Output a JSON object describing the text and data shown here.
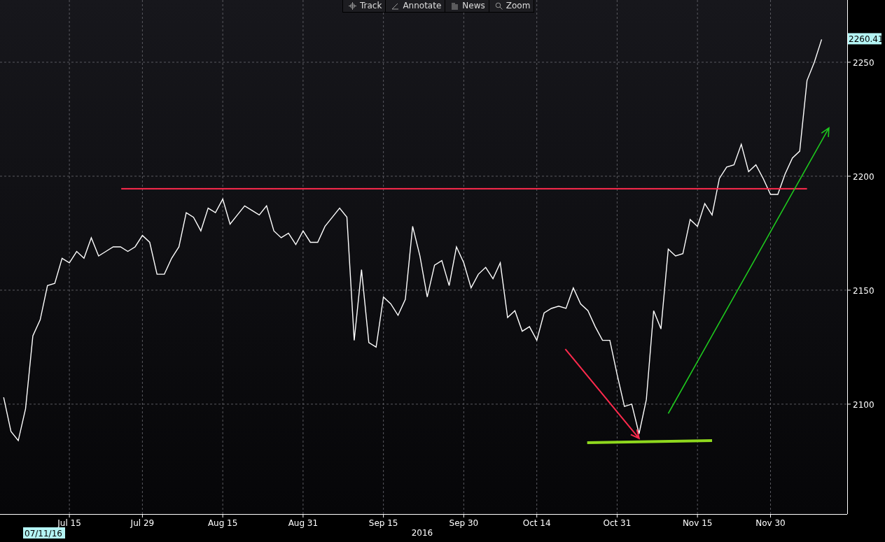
{
  "toolbar": [
    {
      "label": "Track",
      "kind": "track"
    },
    {
      "label": "Annotate",
      "kind": "annotate"
    },
    {
      "label": "News",
      "kind": "news"
    },
    {
      "label": "Zoom",
      "kind": "zoom"
    }
  ],
  "chart": {
    "last_price": "2260.41",
    "start_date": "07/11/16",
    "year_label": "2016",
    "drawings": [
      {
        "kind": "resistance",
        "color": "#ff2a4d"
      },
      {
        "kind": "down-arrow",
        "color": "#ff2a4d"
      },
      {
        "kind": "support",
        "color": "#8fd81e"
      },
      {
        "kind": "up-arrow",
        "color": "#1ec81e"
      }
    ],
    "chart_data": {
      "type": "line",
      "grid": true,
      "ylim": [
        2051.8,
        2277.3
      ],
      "yticks": [
        2100,
        2150,
        2200,
        2250
      ],
      "categories": [
        null,
        null,
        null,
        null,
        null,
        null,
        null,
        null,
        null,
        "Jul 15",
        null,
        null,
        null,
        null,
        null,
        null,
        null,
        null,
        null,
        "Jul 29",
        null,
        null,
        null,
        null,
        null,
        null,
        null,
        null,
        null,
        null,
        "Aug 15",
        null,
        null,
        null,
        null,
        null,
        null,
        null,
        null,
        null,
        null,
        "Aug 31",
        null,
        null,
        null,
        null,
        null,
        null,
        null,
        null,
        null,
        null,
        "Sep 15",
        null,
        null,
        null,
        null,
        null,
        null,
        null,
        null,
        null,
        null,
        "Sep 30",
        null,
        null,
        null,
        null,
        null,
        null,
        null,
        null,
        null,
        "Oct 14",
        null,
        null,
        null,
        null,
        null,
        null,
        null,
        null,
        null,
        null,
        "Oct 31",
        null,
        null,
        null,
        null,
        null,
        null,
        null,
        null,
        null,
        null,
        "Nov 15",
        null,
        null,
        null,
        null,
        null,
        null,
        null,
        null,
        null,
        "Nov 30",
        null,
        null,
        null,
        null,
        null,
        null,
        null,
        null,
        null,
        null
      ],
      "series": [
        {
          "color": "#ffffff",
          "values": [
            2103,
            2088,
            2084,
            2098,
            2130,
            2137,
            2152,
            2153,
            2164,
            2162,
            2167,
            2164,
            2173,
            2165,
            2167,
            2169,
            2169,
            2167,
            2169,
            2174,
            2171,
            2157,
            2157,
            2164,
            2169,
            2184,
            2182,
            2176,
            2186,
            2184,
            2190,
            2179,
            2183,
            2187,
            2185,
            2183,
            2187,
            2176,
            2173,
            2175,
            2170,
            2176,
            2171,
            2171,
            2178,
            2182,
            2186,
            2182,
            2128,
            2159,
            2127,
            2125,
            2147,
            2144,
            2139,
            2146,
            2178,
            2165,
            2147,
            2161,
            2163,
            2152,
            2169,
            2162,
            2151,
            2157,
            2160,
            2155,
            2162,
            2138,
            2141,
            2132,
            2134,
            2128,
            2140,
            2142,
            2143,
            2142,
            2151,
            2144,
            2141,
            2134,
            2128,
            2128,
            2113,
            2099,
            2100,
            2087,
            2102,
            2141,
            2133,
            2168,
            2165,
            2166,
            2181,
            2178,
            2188,
            2183,
            2199,
            2204,
            2205,
            2214,
            2202,
            2205,
            2199,
            2192,
            2192,
            2201,
            2208,
            2211,
            2242,
            2250,
            2260,
            null,
            null,
            null
          ]
        }
      ]
    }
  }
}
